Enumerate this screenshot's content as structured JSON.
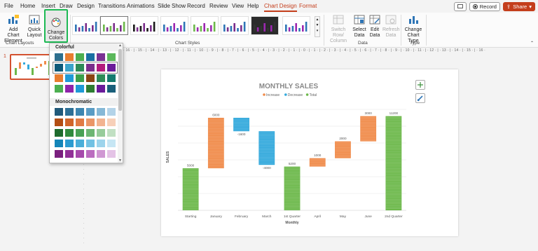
{
  "menu": {
    "tabs": [
      "File",
      "Home",
      "Insert",
      "Draw",
      "Design",
      "Transitions",
      "Animations",
      "Slide Show",
      "Record",
      "Review",
      "View",
      "Help",
      "Chart Design",
      "Format"
    ],
    "active_tab": "Chart Design",
    "record_label": "Record",
    "share_label": "Share"
  },
  "ribbon": {
    "add_chart_element": "Add Chart Element",
    "quick_layout": "Quick Layout",
    "change_colors": "Change Colors",
    "chart_layouts_label": "Chart Layouts",
    "chart_styles_label": "Chart Styles",
    "switch_row_column": "Switch Row/ Column",
    "select_data": "Select Data",
    "edit_data": "Edit Data",
    "refresh_data": "Refresh Data",
    "data_label": "Data",
    "change_chart_type": "Change Chart Type",
    "type_label": "Type"
  },
  "color_dropdown": {
    "colorful_label": "Colorful",
    "monochromatic_label": "Monochromatic",
    "colorful_rows": [
      [
        "#2e6f8e",
        "#e87d2f",
        "#4caf50",
        "#1a6fa3",
        "#7b3294",
        "#5bb85b"
      ],
      [
        "#0e5a7a",
        "#3aa3c9",
        "#2e8b57",
        "#7b2d8b",
        "#b31b7c",
        "#6a1b9a"
      ],
      [
        "#e87d2f",
        "#1f9ad6",
        "#3aa04a",
        "#8b4513",
        "#2e8b57",
        "#147a6e"
      ],
      [
        "#4caf50",
        "#8e24aa",
        "#1f9ad6",
        "#2e7d32",
        "#6a1b9a",
        "#1a5f7a"
      ]
    ],
    "mono_rows": [
      [
        "#215a7a",
        "#2d6f95",
        "#3d86b0",
        "#5a9cc4",
        "#86b8d6",
        "#b3d3e8"
      ],
      [
        "#b34e14",
        "#d0652a",
        "#e07b45",
        "#ea9667",
        "#f2b491",
        "#f7d0b9"
      ],
      [
        "#1e6b2e",
        "#2f8a3d",
        "#48a155",
        "#6cb673",
        "#97cc9b",
        "#c1e0c3"
      ],
      [
        "#1485b8",
        "#2b9bd0",
        "#4aaed9",
        "#72c1e3",
        "#9dd4ec",
        "#c6e6f4"
      ],
      [
        "#7a1f7e",
        "#913097",
        "#a64aac",
        "#bb6dc0",
        "#d098d3",
        "#e4c3e6"
      ]
    ]
  },
  "slides": {
    "current_number": "1"
  },
  "ruler": {
    "marks": "· 16 · | · 15 · | · 14 · | · 13 · | · 12 · | · 11 · | · 10 · | · 9 · | · 8 · | · 7 · | · 6 · | · 5 · | · 4 · | · 3 · | · 2 · | · 1 · | · 0 · | · 1 · | · 2 · | · 3 · | · 4 · | · 5 · | · 6 · | · 7 · | · 8 · | · 9 · | · 10 · | · 11 · | · 12 · | · 13 · | · 14 · | · 15 · | · 16 ·"
  },
  "colors": {
    "accent": "#c43e1c",
    "increase": "#f08b4a",
    "decrease": "#33a9dc",
    "total": "#6cb84a",
    "highlight": "#1db954"
  },
  "chart_data": {
    "type": "waterfall",
    "title": "MONTHLY SALES",
    "legend": [
      "Increase",
      "Decrease",
      "Total"
    ],
    "legend_position": "top",
    "xlabel": "Monthly",
    "ylabel": "SALES",
    "ylim": [
      0,
      13000
    ],
    "grid": true,
    "categories": [
      "Starting",
      "January",
      "February",
      "March",
      "1st Quarter",
      "April",
      "May",
      "June",
      "2nd Quarter"
    ],
    "values": [
      5000,
      6000,
      -1600,
      -4000,
      5200,
      1000,
      2000,
      3000,
      11200
    ],
    "kinds": [
      "total",
      "increase",
      "decrease",
      "decrease",
      "total",
      "increase",
      "increase",
      "increase",
      "total"
    ],
    "data_labels": [
      "5000",
      "6000",
      "-1600",
      "-4000",
      "5200",
      "1000",
      "2000",
      "3000",
      "11200"
    ]
  }
}
